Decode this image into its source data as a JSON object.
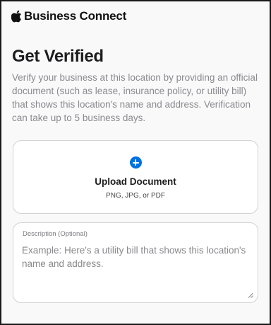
{
  "header": {
    "brand_name": "Business Connect",
    "brand_icon": "apple-logo-icon"
  },
  "main": {
    "title": "Get Verified",
    "description": "Verify your business at this location by providing an official document (such as lease, insurance policy, or utility bill) that shows this location's name and address. Verification can take up to 5 business days.",
    "upload": {
      "icon": "plus-circle-icon",
      "accent_color": "#0071e3",
      "label": "Upload Document",
      "formats": "PNG, JPG, or PDF"
    },
    "description_field": {
      "label": "Description (Optional)",
      "value": "",
      "placeholder": "Example: Here's a utility bill that shows this location's name and address."
    }
  }
}
